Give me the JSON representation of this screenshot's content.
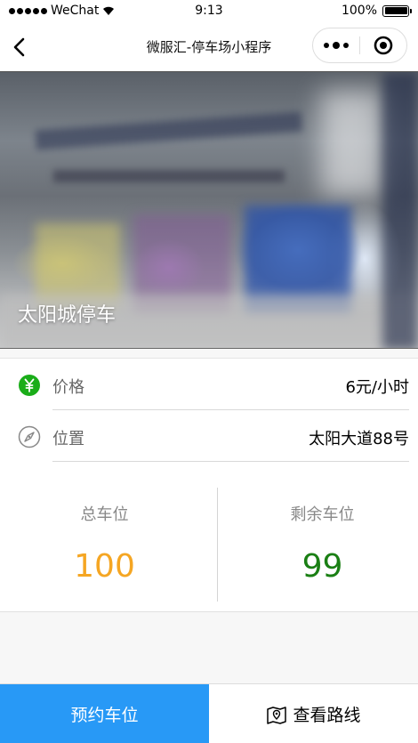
{
  "status_bar": {
    "carrier": "WeChat",
    "time": "9:13",
    "battery_percent": "100%",
    "battery_level": 1.0
  },
  "nav": {
    "title": "微服汇-停车场小程序",
    "back_icon": "chevron-left-icon",
    "more_icon": "more-dots-icon",
    "close_icon": "target-close-icon"
  },
  "hero": {
    "name": "太阳城停车"
  },
  "details": [
    {
      "icon": "yuan-coin-icon",
      "label": "价格",
      "value": "6元/小时",
      "icon_color": "#1aad19"
    },
    {
      "icon": "compass-icon",
      "label": "位置",
      "value": "太阳大道88号",
      "icon_color": "#888888"
    }
  ],
  "stats": {
    "total": {
      "label": "总车位",
      "value": "100",
      "color": "#f5a623"
    },
    "remaining": {
      "label": "剩余车位",
      "value": "99",
      "color": "#1a7f14"
    }
  },
  "actions": {
    "book_label": "预约车位",
    "route_label": "查看路线",
    "book_color": "#2899f6",
    "route_icon": "map-icon"
  }
}
